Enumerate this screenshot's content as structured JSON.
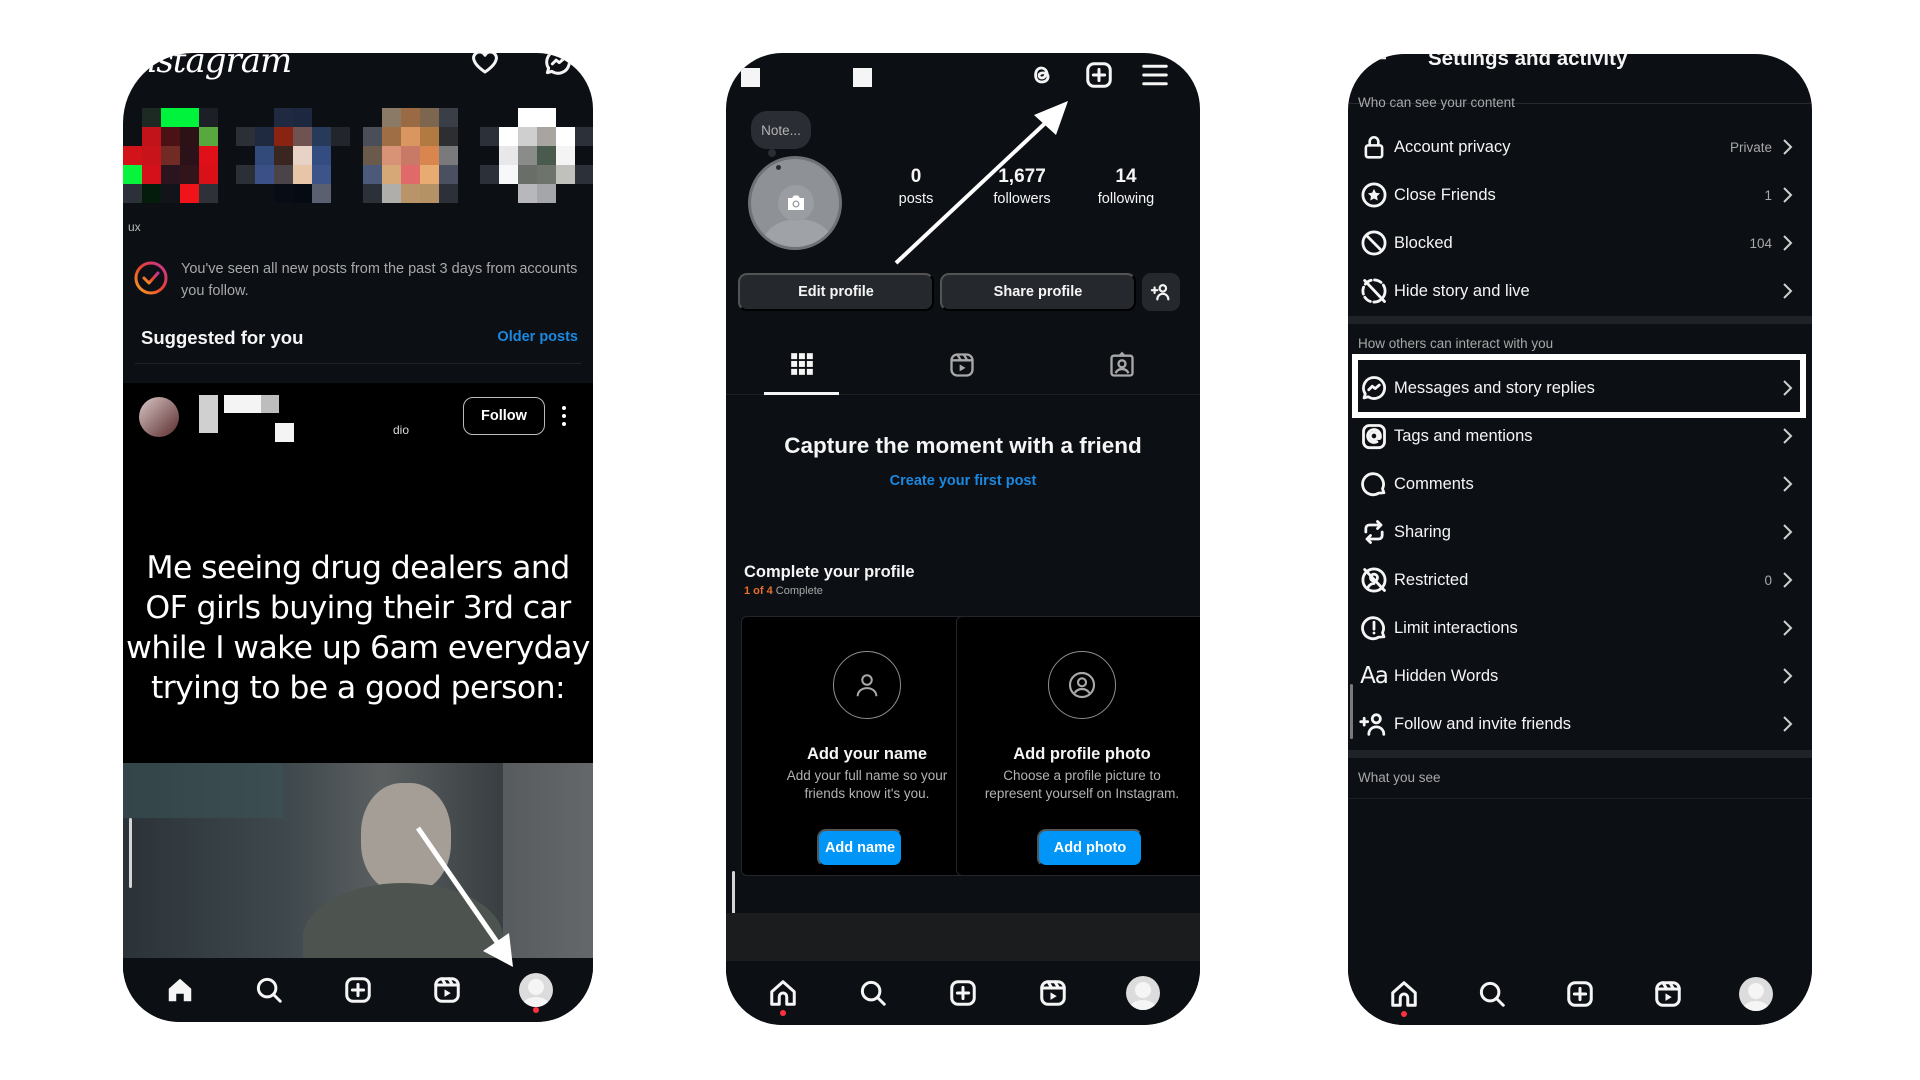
{
  "phone1": {
    "app_logo": "Instagram",
    "header_icons": [
      "heart-icon",
      "messenger-icon"
    ],
    "story_name_fragment": "ux",
    "seen_all_text": "You've seen all new posts from the past 3 days from accounts you follow.",
    "suggested_title": "Suggested for you",
    "older_posts_link": "Older posts",
    "suggested_post": {
      "subtitle_fragment": "dio",
      "follow_button": "Follow",
      "more_icon": "more-vertical-icon",
      "caption": "Me seeing drug dealers and OF girls buying their 3rd car while I wake up 6am everyday trying to be a good person:"
    },
    "nav": [
      "home-filled-icon",
      "search-icon",
      "create-icon",
      "reels-icon",
      "profile-avatar"
    ]
  },
  "phone2": {
    "header_icons": [
      "threads-icon",
      "create-icon",
      "menu-icon"
    ],
    "note_bubble": "Note...",
    "stats": [
      {
        "value": "0",
        "label": "posts"
      },
      {
        "value": "1,677",
        "label": "followers"
      },
      {
        "value": "14",
        "label": "following"
      }
    ],
    "buttons": {
      "edit": "Edit profile",
      "share": "Share profile"
    },
    "tabs": [
      "grid-icon",
      "reels-icon",
      "tagged-icon"
    ],
    "empty_title": "Capture the moment with a friend",
    "empty_link": "Create your first post",
    "complete_profile": {
      "title": "Complete your profile",
      "progress_count": "1 of 4",
      "progress_word": "Complete",
      "progress_fraction": 0.25
    },
    "cards": [
      {
        "title": "Add your name",
        "desc_line1": "Add your full name so your",
        "desc_line2": "friends know it's you.",
        "button": "Add name"
      },
      {
        "title": "Add profile photo",
        "desc_line1": "Choose a profile picture to",
        "desc_line2": "represent yourself on Instagram.",
        "button": "Add photo"
      }
    ],
    "nav": [
      "home-icon",
      "search-icon",
      "create-icon",
      "reels-icon",
      "profile-avatar"
    ]
  },
  "phone3": {
    "title": "Settings and activity",
    "sections": [
      {
        "header": "Who can see your content",
        "items": [
          {
            "icon": "lock-icon",
            "label": "Account privacy",
            "value": "Private"
          },
          {
            "icon": "star-circle-icon",
            "label": "Close Friends",
            "value": "1"
          },
          {
            "icon": "blocked-icon",
            "label": "Blocked",
            "value": "104"
          },
          {
            "icon": "hide-story-icon",
            "label": "Hide story and live",
            "value": ""
          }
        ]
      },
      {
        "header": "How others can interact with you",
        "items": [
          {
            "icon": "messenger-icon",
            "label": "Messages and story replies",
            "value": "",
            "highlighted": true
          },
          {
            "icon": "at-sign-icon",
            "label": "Tags and mentions",
            "value": ""
          },
          {
            "icon": "comment-icon",
            "label": "Comments",
            "value": ""
          },
          {
            "icon": "sharing-icon",
            "label": "Sharing",
            "value": ""
          },
          {
            "icon": "restricted-icon",
            "label": "Restricted",
            "value": "0"
          },
          {
            "icon": "limit-icon",
            "label": "Limit interactions",
            "value": ""
          },
          {
            "icon": "hidden-words-icon",
            "label": "Hidden Words",
            "value": ""
          },
          {
            "icon": "add-person-icon",
            "label": "Follow and invite friends",
            "value": ""
          }
        ]
      },
      {
        "header": "What you see",
        "items": []
      }
    ],
    "hidden_words_glyph": "Aa",
    "nav": [
      "home-icon",
      "search-icon",
      "create-icon",
      "reels-icon",
      "profile-avatar"
    ]
  },
  "colors": {
    "background": "#0c0f14",
    "link_blue": "#1b88e0",
    "button_blue": "#0095f6",
    "progress_orange": "#e8702a",
    "notification_red": "#ff3040"
  }
}
